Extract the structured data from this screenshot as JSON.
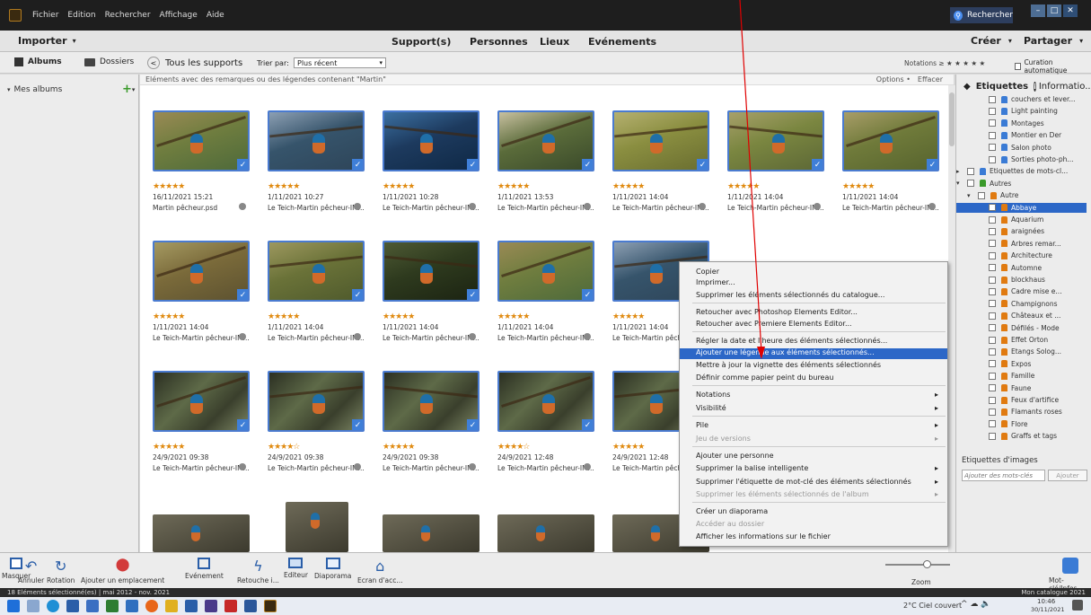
{
  "titlebar": {
    "menus": [
      "Fichier",
      "Edition",
      "Rechercher",
      "Affichage",
      "Aide"
    ],
    "search_label": "Rechercher",
    "winbtns": [
      "–",
      "□",
      "✕"
    ]
  },
  "tabbar": {
    "import_label": "Importer",
    "tabs": [
      "Support(s)",
      "Personnes",
      "Lieux",
      "Evénements"
    ],
    "create_label": "Créer",
    "share_label": "Partager"
  },
  "row3": {
    "albums_label": "Albums",
    "folders_label": "Dossiers",
    "back_label": "<",
    "all_media_label": "Tous les supports",
    "sort_label": "Trier par:",
    "sort_value": "Plus récent",
    "ratings_label": "Notations ≥ ★ ★ ★ ★ ★",
    "auto_curation_label": "Curation automatique"
  },
  "leftpanel": {
    "my_albums_label": "Mes albums",
    "add_label": "+"
  },
  "grid": {
    "header_text": "Eléments avec des remarques ou des légendes contenant \"Martin\"",
    "options_label": "Options •",
    "clear_label": "Effacer",
    "rows": [
      [
        {
          "stars": "★★★★★",
          "date": "16/11/2021 15:21",
          "name": "Martin pêcheur.psd"
        },
        {
          "stars": "★★★★★",
          "date": "1/11/2021 10:27",
          "name": "Le Teich-Martin pêcheur-IM..."
        },
        {
          "stars": "★★★★★",
          "date": "1/11/2021 10:28",
          "name": "Le Teich-Martin pêcheur-IM..."
        },
        {
          "stars": "★★★★★",
          "date": "1/11/2021 13:53",
          "name": "Le Teich-Martin pêcheur-IM..."
        },
        {
          "stars": "★★★★★",
          "date": "1/11/2021 14:04",
          "name": "Le Teich-Martin pêcheur-IM..."
        },
        {
          "stars": "★★★★★",
          "date": "1/11/2021 14:04",
          "name": "Le Teich-Martin pêcheur-IM..."
        },
        {
          "stars": "★★★★★",
          "date": "1/11/2021 14:04",
          "name": "Le Teich-Martin pêcheur-IM..."
        }
      ],
      [
        {
          "stars": "★★★★★",
          "date": "1/11/2021 14:04",
          "name": "Le Teich-Martin pêcheur-IM..."
        },
        {
          "stars": "★★★★★",
          "date": "1/11/2021 14:04",
          "name": "Le Teich-Martin pêcheur-IM..."
        },
        {
          "stars": "★★★★★",
          "date": "1/11/2021 14:04",
          "name": "Le Teich-Martin pêcheur-IM..."
        },
        {
          "stars": "★★★★★",
          "date": "1/11/2021 14:04",
          "name": "Le Teich-Martin pêcheur-IM..."
        },
        {
          "stars": "★★★★★",
          "date": "1/11/2021 14:04",
          "name": "Le Teich-Martin pêcheur"
        }
      ],
      [
        {
          "stars": "★★★★★",
          "date": "24/9/2021 09:38",
          "name": "Le Teich-Martin pêcheur-IM..."
        },
        {
          "stars": "★★★★☆",
          "date": "24/9/2021 09:38",
          "name": "Le Teich-Martin pêcheur-IM..."
        },
        {
          "stars": "★★★★★",
          "date": "24/9/2021 09:38",
          "name": "Le Teich-Martin pêcheur-IM..."
        },
        {
          "stars": "★★★★☆",
          "date": "24/9/2021 12:48",
          "name": "Le Teich-Martin pêcheur-IM..."
        },
        {
          "stars": "★★★★★",
          "date": "24/9/2021 12:48",
          "name": "Le Teich-Martin pêcheur"
        }
      ]
    ]
  },
  "rightpanel": {
    "tab_tags": "Etiquettes",
    "tab_info": "Informatio...",
    "tree": [
      "couchers et lever...",
      "Light painting",
      "Montages",
      "Montier en Der",
      "Salon photo",
      "Sorties photo-ph...",
      "Etiquettes de mots-cl...",
      "Autres",
      "Autre",
      "Abbaye",
      "Aquarium",
      "araignées",
      "Arbres remar...",
      "Architecture",
      "Automne",
      "blockhaus",
      "Cadre mise e...",
      "Champignons",
      "Châteaux et ...",
      "Défilés - Mode",
      "Effet Orton",
      "Etangs Solog...",
      "Expos",
      "Famille",
      "Faune",
      "Feux d'artifice",
      "Flamants roses",
      "Flore",
      "Graffs et tags"
    ],
    "image_tags_label": "Etiquettes d'images",
    "add_tags_placeholder": "Ajouter des mots-clés",
    "add_button": "Ajouter"
  },
  "context_menu": {
    "items": [
      {
        "label": "Copier"
      },
      {
        "label": "Imprimer..."
      },
      {
        "label": "Supprimer les éléments sélectionnés du catalogue..."
      },
      {
        "label": "Retoucher avec Photoshop Elements Editor..."
      },
      {
        "label": "Retoucher avec Premiere Elements Editor..."
      },
      {
        "label": "Régler la date et l'heure des éléments sélectionnés..."
      },
      {
        "label": "Ajouter une légende aux éléments sélectionnés..."
      },
      {
        "label": "Mettre à jour la vignette des éléments sélectionnés"
      },
      {
        "label": "Définir comme papier peint du bureau"
      },
      {
        "label": "Notations"
      },
      {
        "label": "Visibilité"
      },
      {
        "label": "Pile"
      },
      {
        "label": "Jeu de versions"
      },
      {
        "label": "Ajouter une personne"
      },
      {
        "label": "Supprimer la balise intelligente"
      },
      {
        "label": "Supprimer l'étiquette de mot-clé des éléments sélectionnés"
      },
      {
        "label": "Supprimer les éléments sélectionnés de l'album"
      },
      {
        "label": "Créer un diaporama"
      },
      {
        "label": "Accéder au dossier"
      },
      {
        "label": "Afficher les informations sur le fichier"
      }
    ]
  },
  "toolbar": {
    "tools": [
      "Masquer",
      "Annuler",
      "Rotation",
      "Ajouter un emplacement",
      "Evénement",
      "Retouche i...",
      "Editeur",
      "Diaporama",
      "Ecran d'acc..."
    ],
    "zoom_label": "Zoom",
    "keyword_info_label": "Mot-clé/Infos"
  },
  "statusbar": {
    "left_text": "18 Eléments sélectionné(es) | mai 2012 - nov. 2021",
    "right_text": "Mon catalogue 2021"
  },
  "taskbar": {
    "weather": "2°C  Ciel couvert",
    "time": "10:46",
    "date": "30/11/2021"
  },
  "colors": {
    "accent": "#2c67c7",
    "star": "#e08a10",
    "tag": "#e07a10",
    "annotation": "#e00000"
  }
}
